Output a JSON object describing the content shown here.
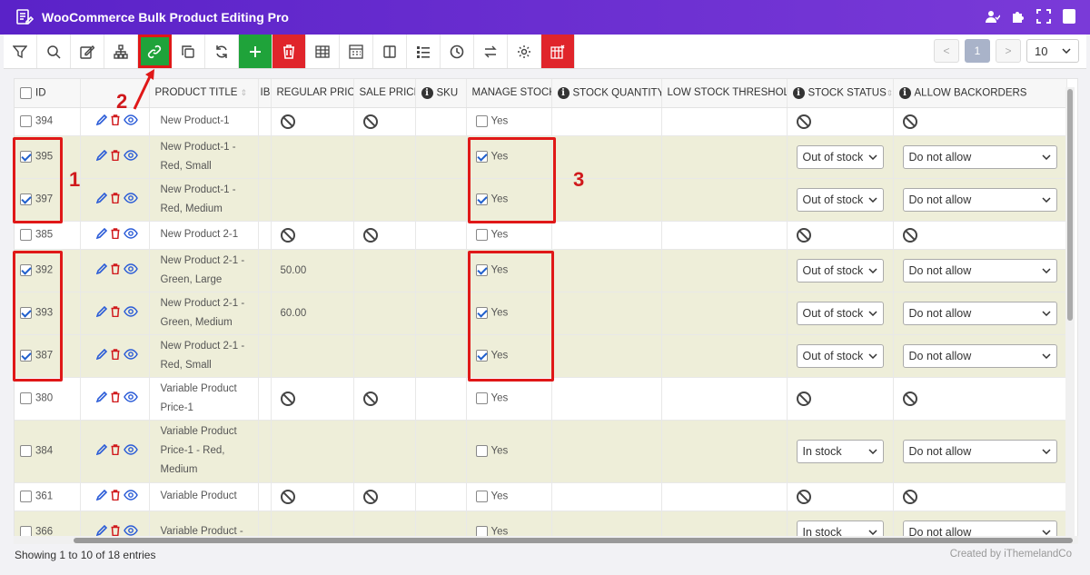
{
  "app": {
    "title": "WooCommerce Bulk Product Editing Pro"
  },
  "toolbar": {
    "buttons": [
      "filter-icon",
      "search-icon",
      "edit-icon",
      "hierarchy-icon",
      "link-icon",
      "duplicate-icon",
      "refresh-icon",
      "add-icon",
      "delete-icon",
      "table-icon",
      "calculator-icon",
      "columns-icon",
      "list-icon",
      "history-icon",
      "swap-icon",
      "settings-icon",
      "bind-edit-icon"
    ],
    "pager": {
      "prev": "<",
      "current": "1",
      "next": ">",
      "per_page": "10"
    }
  },
  "table": {
    "headers": {
      "id": "ID",
      "product_title": "PRODUCT TITLE",
      "ib": "IB",
      "regular_price": "REGULAR PRICE",
      "sale_price": "SALE PRICE",
      "sku": "SKU",
      "manage_stock": "MANAGE STOCK",
      "stock_quantity": "STOCK QUANTITY",
      "low_stock": "LOW STOCK THRESHOLD",
      "stock_status": "STOCK STATUS",
      "allow_backorders": "ALLOW BACKORDERS"
    },
    "rows": [
      {
        "id": "394",
        "checked": false,
        "title_1": "New Product-1",
        "title_2": "",
        "title_3": "",
        "regular": "",
        "sale": "",
        "manage": "Yes",
        "manage_checked": false,
        "status": "",
        "backorders": ""
      },
      {
        "id": "395",
        "checked": true,
        "title_1": "New Product-1 -",
        "title_2": "Red, Small",
        "title_3": "",
        "regular": "",
        "sale": "",
        "manage": "Yes",
        "manage_checked": true,
        "status": "Out of stock",
        "backorders": "Do not allow"
      },
      {
        "id": "397",
        "checked": true,
        "title_1": "New Product-1 -",
        "title_2": "Red, Medium",
        "title_3": "",
        "regular": "",
        "sale": "",
        "manage": "Yes",
        "manage_checked": true,
        "status": "Out of stock",
        "backorders": "Do not allow"
      },
      {
        "id": "385",
        "checked": false,
        "title_1": "New Product 2-1",
        "title_2": "",
        "title_3": "",
        "regular": "",
        "sale": "",
        "manage": "Yes",
        "manage_checked": false,
        "status": "",
        "backorders": ""
      },
      {
        "id": "392",
        "checked": true,
        "title_1": "New Product 2-1 -",
        "title_2": "Green, Large",
        "title_3": "",
        "regular": "50.00",
        "sale": "",
        "manage": "Yes",
        "manage_checked": true,
        "status": "Out of stock",
        "backorders": "Do not allow"
      },
      {
        "id": "393",
        "checked": true,
        "title_1": "New Product 2-1 -",
        "title_2": "Green, Medium",
        "title_3": "",
        "regular": "60.00",
        "sale": "",
        "manage": "Yes",
        "manage_checked": true,
        "status": "Out of stock",
        "backorders": "Do not allow"
      },
      {
        "id": "387",
        "checked": true,
        "title_1": "New Product 2-1 -",
        "title_2": "Red, Small",
        "title_3": "",
        "regular": "",
        "sale": "",
        "manage": "Yes",
        "manage_checked": true,
        "status": "Out of stock",
        "backorders": "Do not allow"
      },
      {
        "id": "380",
        "checked": false,
        "title_1": "Variable Product",
        "title_2": "Price-1",
        "title_3": "",
        "regular": "",
        "sale": "",
        "manage": "Yes",
        "manage_checked": false,
        "status": "",
        "backorders": ""
      },
      {
        "id": "384",
        "checked": false,
        "title_1": "Variable Product",
        "title_2": "Price-1 - Red,",
        "title_3": "Medium",
        "regular": "",
        "sale": "",
        "manage": "Yes",
        "manage_checked": false,
        "status": "In stock",
        "backorders": "Do not allow"
      },
      {
        "id": "361",
        "checked": false,
        "title_1": "Variable Product",
        "title_2": "",
        "title_3": "",
        "regular": "",
        "sale": "",
        "manage": "Yes",
        "manage_checked": false,
        "status": "",
        "backorders": ""
      },
      {
        "id": "366",
        "checked": false,
        "title_1": "Variable Product -",
        "title_2": "",
        "title_3": "",
        "regular": "",
        "sale": "",
        "manage": "Yes",
        "manage_checked": false,
        "status": "In stock",
        "backorders": "Do not allow"
      }
    ]
  },
  "annotations": {
    "n1": "1",
    "n2": "2",
    "n3": "3"
  },
  "footer": {
    "showing": "Showing 1 to 10 of 18 entries",
    "credit": "Created by iThemelandCo"
  }
}
